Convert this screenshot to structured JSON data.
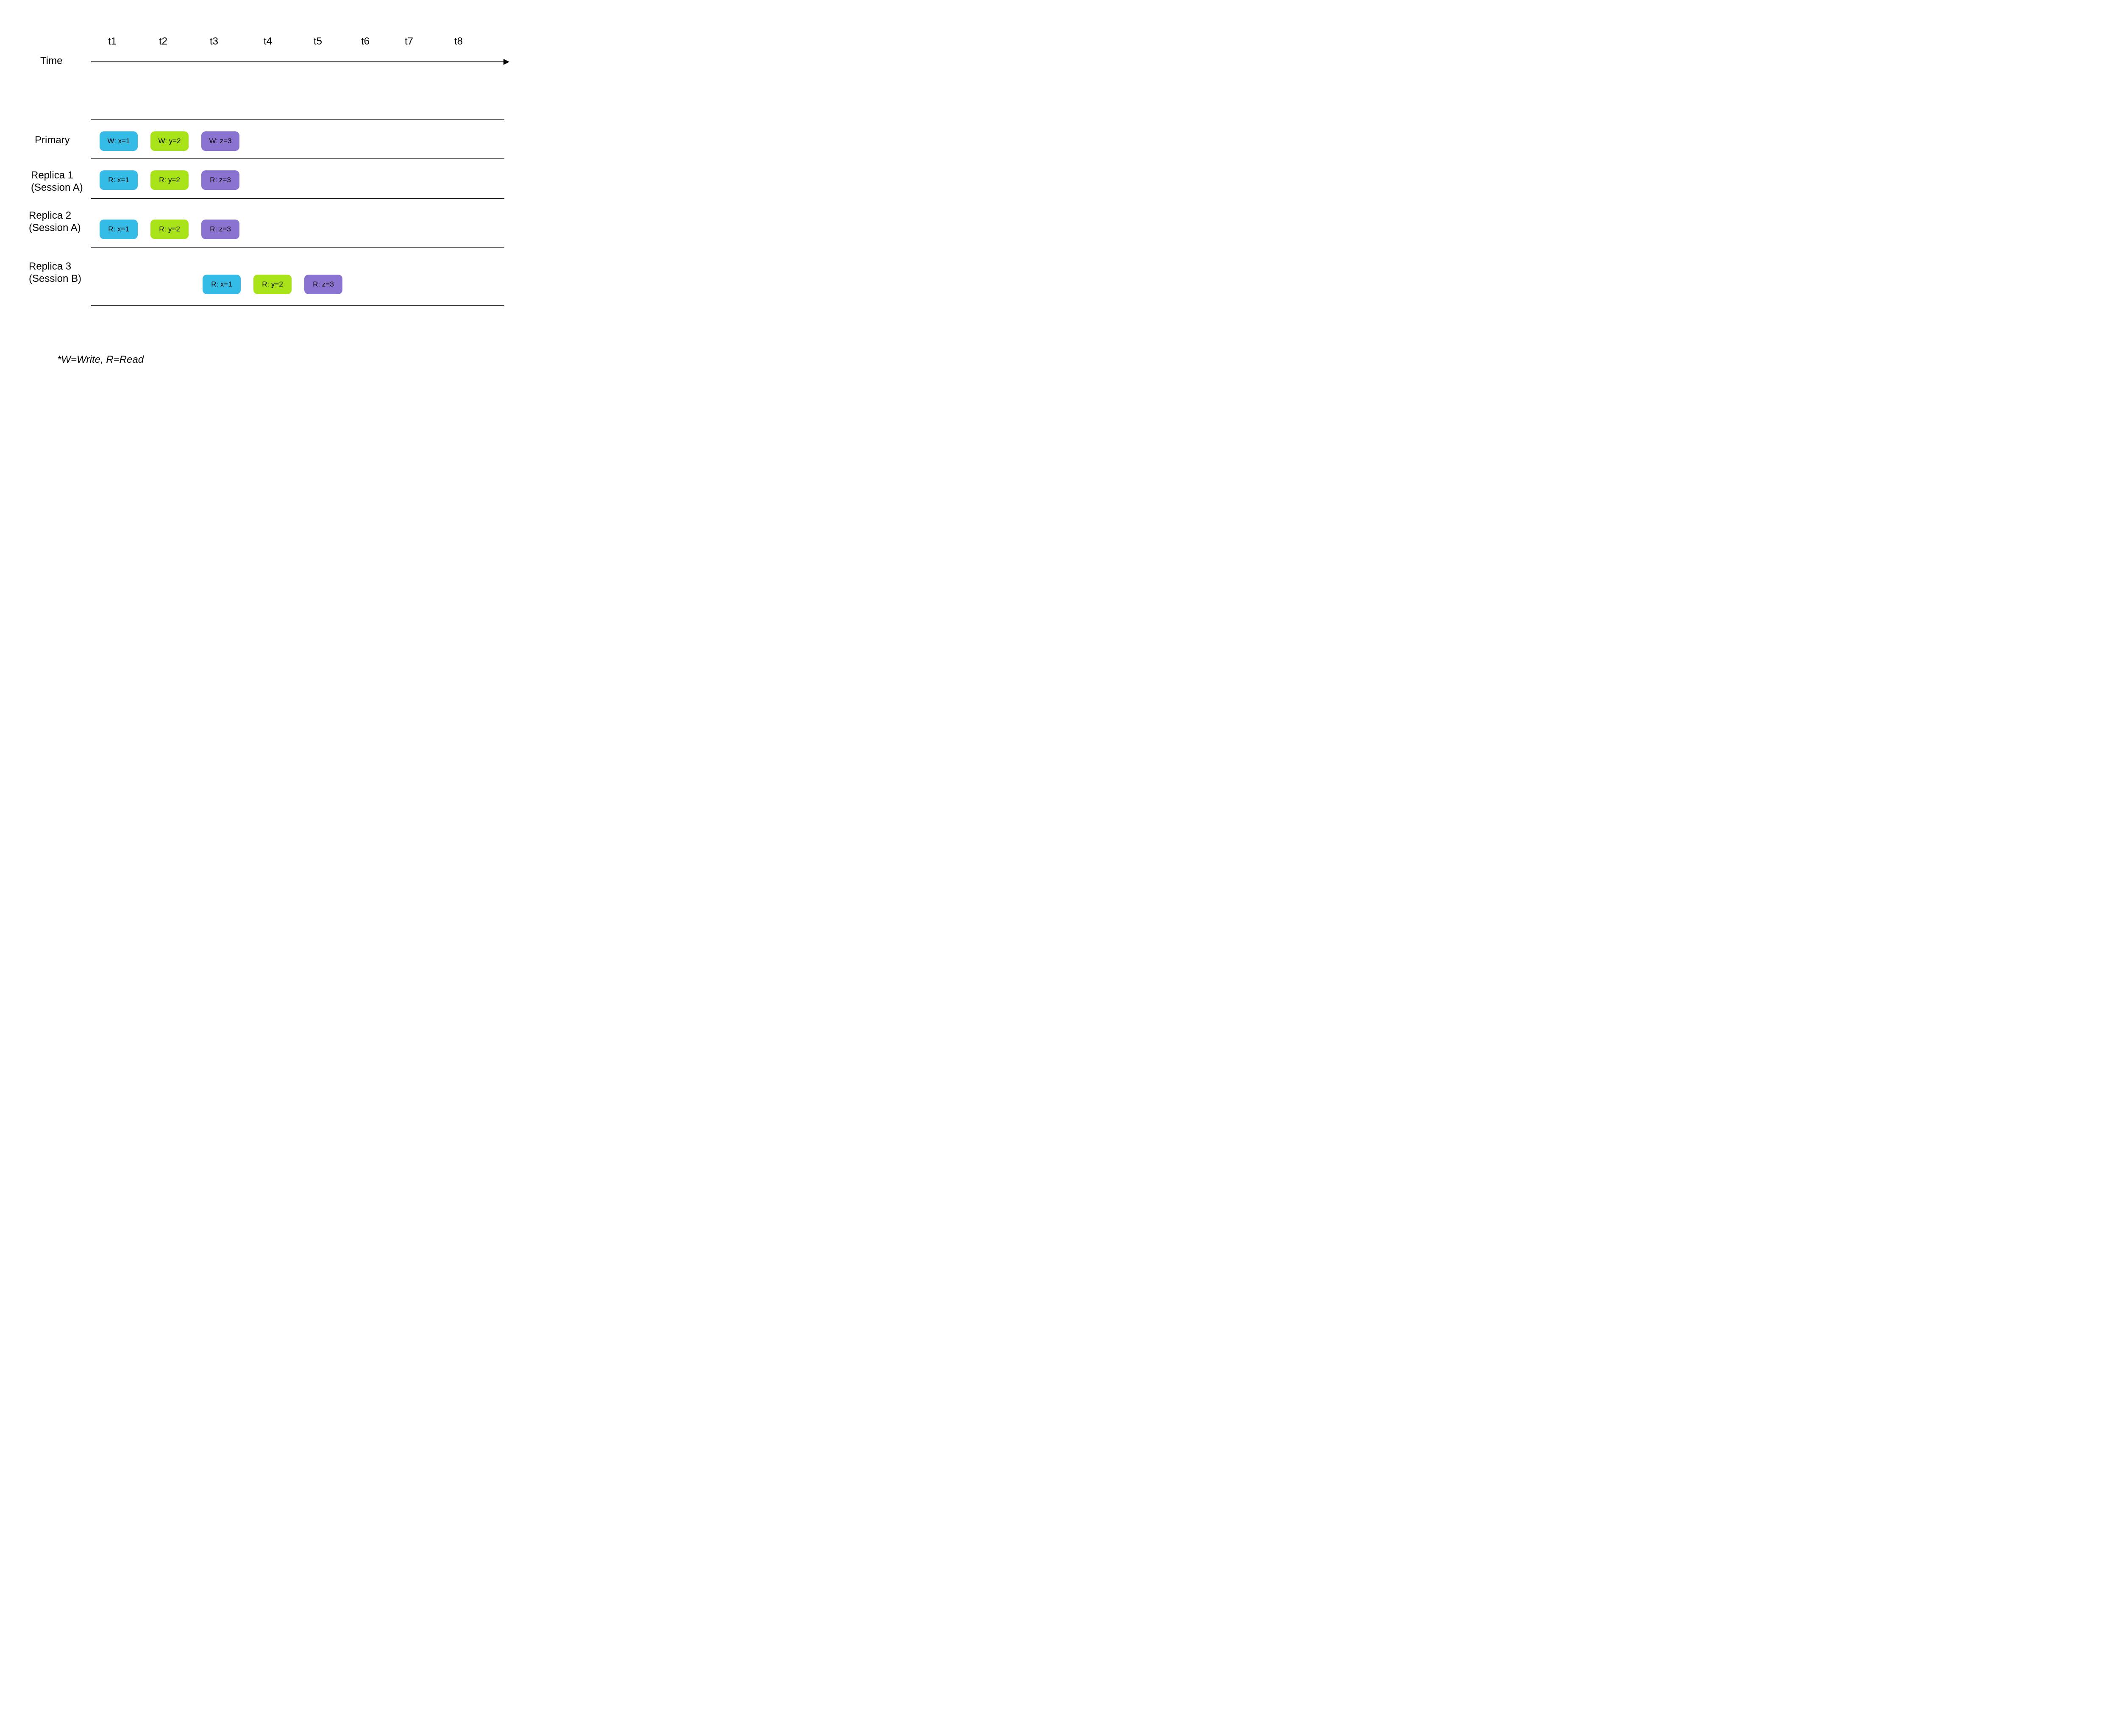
{
  "axis": {
    "label": "Time"
  },
  "ticks": [
    "t1",
    "t2",
    "t3",
    "t4",
    "t5",
    "t6",
    "t7",
    "t8"
  ],
  "rows": {
    "primary": {
      "label": "Primary"
    },
    "replica1": {
      "label_line1": "Replica 1",
      "label_line2": "(Session A)"
    },
    "replica2": {
      "label_line1": "Replica 2",
      "label_line2": "(Session A)"
    },
    "replica3": {
      "label_line1": "Replica 3",
      "label_line2": "(Session B)"
    }
  },
  "ops": {
    "primary": [
      {
        "text": "W: x=1",
        "color": "blue"
      },
      {
        "text": "W: y=2",
        "color": "green"
      },
      {
        "text": "W: z=3",
        "color": "purple"
      }
    ],
    "replica1": [
      {
        "text": "R: x=1",
        "color": "blue"
      },
      {
        "text": "R: y=2",
        "color": "green"
      },
      {
        "text": "R: z=3",
        "color": "purple"
      }
    ],
    "replica2": [
      {
        "text": "R: x=1",
        "color": "blue"
      },
      {
        "text": "R: y=2",
        "color": "green"
      },
      {
        "text": "R: z=3",
        "color": "purple"
      }
    ],
    "replica3": [
      {
        "text": "R: x=1",
        "color": "blue"
      },
      {
        "text": "R: y=2",
        "color": "green"
      },
      {
        "text": "R: z=3",
        "color": "purple"
      }
    ]
  },
  "legend": "*W=Write, R=Read",
  "chart_data": {
    "type": "table",
    "title": "Session-based read consistency timeline",
    "timepoints": [
      "t1",
      "t2",
      "t3",
      "t4",
      "t5",
      "t6",
      "t7",
      "t8"
    ],
    "events": [
      {
        "node": "Primary",
        "session": null,
        "t": "t1",
        "op": "W",
        "key": "x",
        "value": 1
      },
      {
        "node": "Primary",
        "session": null,
        "t": "t2",
        "op": "W",
        "key": "y",
        "value": 2
      },
      {
        "node": "Primary",
        "session": null,
        "t": "t3",
        "op": "W",
        "key": "z",
        "value": 3
      },
      {
        "node": "Replica 1",
        "session": "A",
        "t": "t1",
        "op": "R",
        "key": "x",
        "value": 1
      },
      {
        "node": "Replica 1",
        "session": "A",
        "t": "t2",
        "op": "R",
        "key": "y",
        "value": 2
      },
      {
        "node": "Replica 1",
        "session": "A",
        "t": "t3",
        "op": "R",
        "key": "z",
        "value": 3
      },
      {
        "node": "Replica 2",
        "session": "A",
        "t": "t1",
        "op": "R",
        "key": "x",
        "value": 1
      },
      {
        "node": "Replica 2",
        "session": "A",
        "t": "t2",
        "op": "R",
        "key": "y",
        "value": 2
      },
      {
        "node": "Replica 2",
        "session": "A",
        "t": "t3",
        "op": "R",
        "key": "z",
        "value": 3
      },
      {
        "node": "Replica 3",
        "session": "B",
        "t": "t3",
        "op": "R",
        "key": "x",
        "value": 1
      },
      {
        "node": "Replica 3",
        "session": "B",
        "t": "t4",
        "op": "R",
        "key": "y",
        "value": 2
      },
      {
        "node": "Replica 3",
        "session": "B",
        "t": "t5",
        "op": "R",
        "key": "z",
        "value": 3
      }
    ],
    "legend": {
      "W": "Write",
      "R": "Read"
    }
  }
}
